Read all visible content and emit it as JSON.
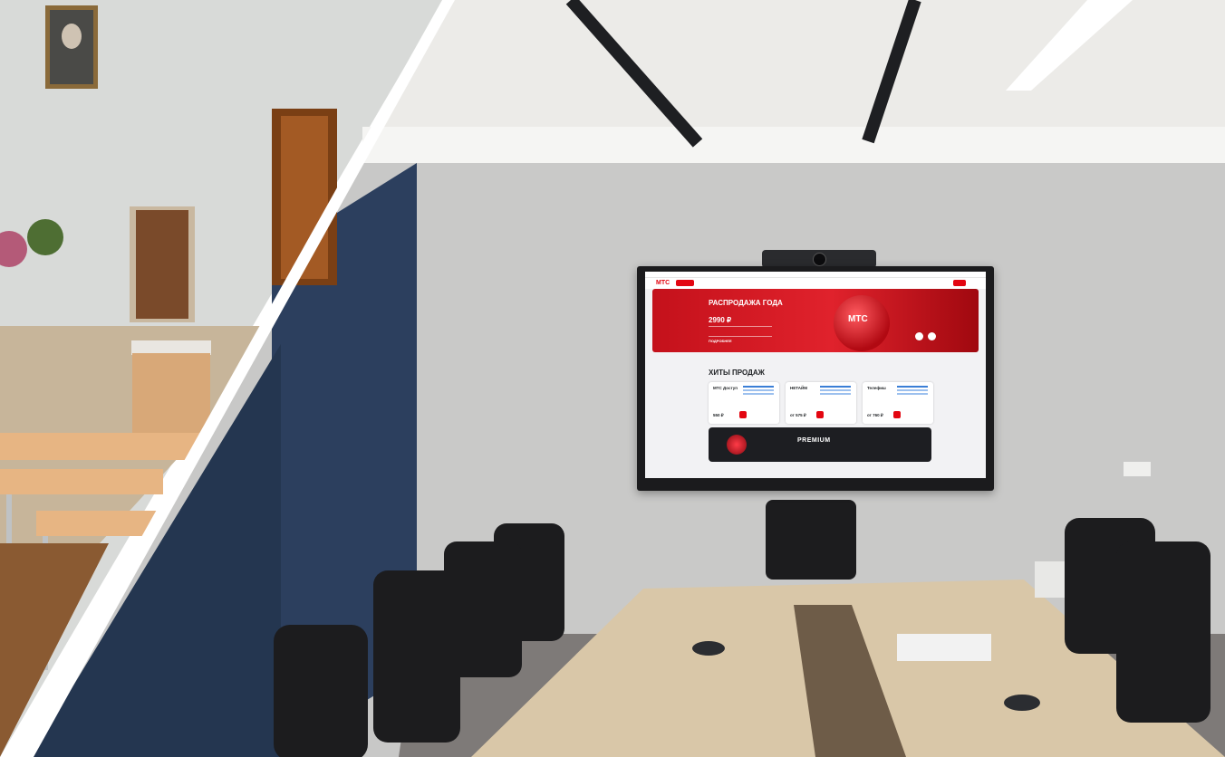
{
  "photo": {
    "left_room": "classroom",
    "right_room": "meeting-room"
  },
  "display": {
    "logo": "МТС",
    "hero": {
      "title": "РАСПРОДАЖА ГОДА",
      "price": "2990 ₽",
      "more": "ПОДРОБНЕЕ",
      "badge": "МТС"
    },
    "section_title": "ХИТЫ ПРОДАЖ",
    "cards": [
      {
        "name": "МТС Доступ",
        "price": "550 ₽"
      },
      {
        "name": "НЕТАЙМ",
        "price": "от 575 ₽"
      },
      {
        "name": "Телефиш",
        "price": "от 760 ₽"
      }
    ],
    "promo": "PREMIUM"
  },
  "colors": {
    "brand_red": "#e30611",
    "wall_left": "#d9dcda",
    "accent_wall": "#243650",
    "wall_right": "#c7c8c7",
    "table": "#d9c7a8",
    "chair": "#1c1c1e"
  }
}
